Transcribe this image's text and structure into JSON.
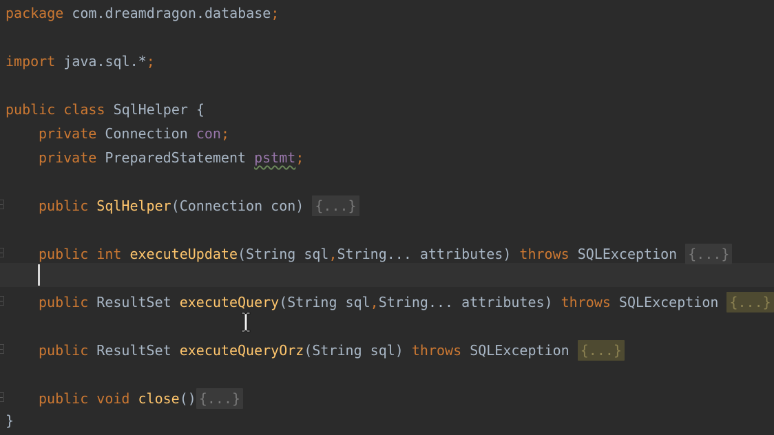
{
  "code": {
    "package_kw": "package",
    "package_name": " com.dreamdragon.database",
    "semicolon": ";",
    "import_kw": "import",
    "import_name": " java.sql.",
    "import_star": "*",
    "public_kw": "public",
    "class_kw": "class",
    "class_name": "SqlHelper",
    "open_brace": "{",
    "close_brace": "}",
    "private_kw": "private",
    "type_connection": "Connection",
    "field_con": "con",
    "type_prepared": "PreparedStatement",
    "field_pstmt": "pstmt",
    "ctor_name": "SqlHelper",
    "ctor_params": "(Connection con) ",
    "int_kw": "int",
    "execute_update": "executeUpdate",
    "update_params_a": "(String sql",
    "comma": ",",
    "update_params_b": "String... attributes) ",
    "throws_kw": "throws",
    "sql_exception": "SQLException",
    "result_set": "ResultSet",
    "execute_query": "executeQuery",
    "query_params_a": "(String sql",
    "query_params_b": "String... attributes) ",
    "execute_query_orz": "executeQueryOrz",
    "orz_params": "(String sql) ",
    "void_kw": "void",
    "close_fn": "close",
    "close_parens": "()",
    "fold_placeholder": "{...}"
  },
  "colors": {
    "background": "#2b2b2b",
    "keyword": "#cc7832",
    "function": "#ffc66d",
    "field": "#9876aa",
    "text": "#a9b7c6"
  },
  "icons": [
    "fold-marker-icon",
    "text-cursor-icon"
  ]
}
